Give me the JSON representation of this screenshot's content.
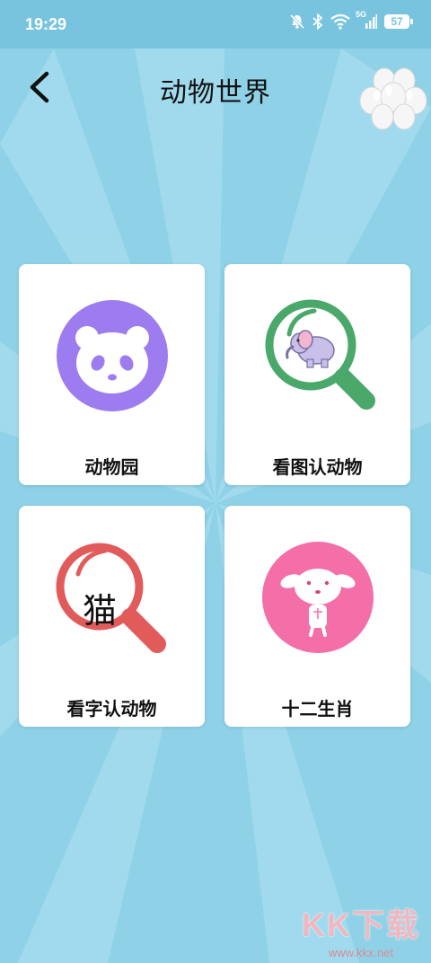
{
  "status_bar": {
    "time": "19:29",
    "network_label": "5G",
    "battery_level": "57",
    "icons": [
      "mute-bell-icon",
      "bluetooth-icon",
      "wifi-icon",
      "signal-icon",
      "battery-icon"
    ]
  },
  "header": {
    "title": "动物世界",
    "back_icon": "chevron-left-icon",
    "decoration": "balloons-icon"
  },
  "menu": {
    "items": [
      {
        "label": "动物园",
        "icon": "panda-icon",
        "color": "#9d7cf0"
      },
      {
        "label": "看图认动物",
        "icon": "elephant-magnifier-icon",
        "color": "#4aa86a"
      },
      {
        "label": "看字认动物",
        "icon": "character-magnifier-icon",
        "color": "#e25b5b",
        "glyph": "猫"
      },
      {
        "label": "十二生肖",
        "icon": "dog-icon",
        "color": "#f46ea8"
      }
    ]
  },
  "watermark": {
    "logo": "KK下载",
    "url": "www.kkx.net"
  },
  "colors": {
    "background": "#8fd2e8",
    "status_bar": "#78c4df",
    "card": "#ffffff"
  }
}
